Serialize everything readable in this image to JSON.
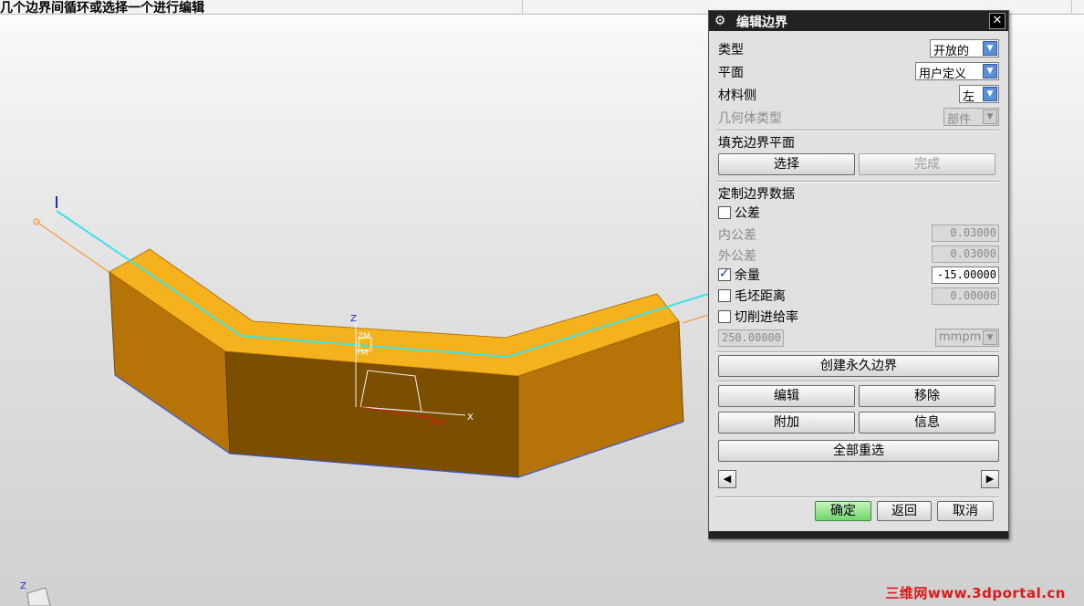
{
  "status_bar": {
    "cue": "几个边界间循环或选择一个进行编辑"
  },
  "viewport": {
    "axis_labels": {
      "z_main": "Z",
      "zm": "ZM",
      "ym": "YM",
      "xm": "XM",
      "x": "X",
      "z_corner": "Z"
    },
    "watermark": "三维网www.3dportal.cn",
    "colors": {
      "top_face": "#f6b21c",
      "side_face": "#7b4e00",
      "front_face": "#b67408",
      "boundary_cyan": "#3fe0e8",
      "boundary_orange": "#f59a3c"
    }
  },
  "dialog": {
    "title": "编辑边界",
    "icon": "gear-icon",
    "type_label": "类型",
    "type_value": "开放的",
    "plane_label": "平面",
    "plane_value": "用户定义",
    "material_side_label": "材料侧",
    "material_side_value": "左",
    "geometry_type_label": "几何体类型",
    "geometry_type_value": "部件",
    "fill_plane_label": "填充边界平面",
    "select_button": "选择",
    "done_button": "完成",
    "custom_data_label": "定制边界数据",
    "tolerance_label": "公差",
    "tolerance_checked": false,
    "inner_tolerance_label": "内公差",
    "inner_tolerance_value": "0.03000",
    "outer_tolerance_label": "外公差",
    "outer_tolerance_value": "0.03000",
    "stock_label": "余量",
    "stock_checked": true,
    "stock_value": "-15.00000",
    "blank_distance_label": "毛坯距离",
    "blank_distance_checked": false,
    "blank_distance_value": "0.00000",
    "feed_rate_label": "切削进给率",
    "feed_rate_checked": false,
    "feed_rate_value": "250.00000",
    "feed_unit_value": "mmpm",
    "create_permanent_button": "创建永久边界",
    "edit_button": "编辑",
    "remove_button": "移除",
    "append_button": "附加",
    "info_button": "信息",
    "reselect_all_button": "全部重选",
    "ok_button": "确定",
    "back_button": "返回",
    "cancel_button": "取消"
  }
}
